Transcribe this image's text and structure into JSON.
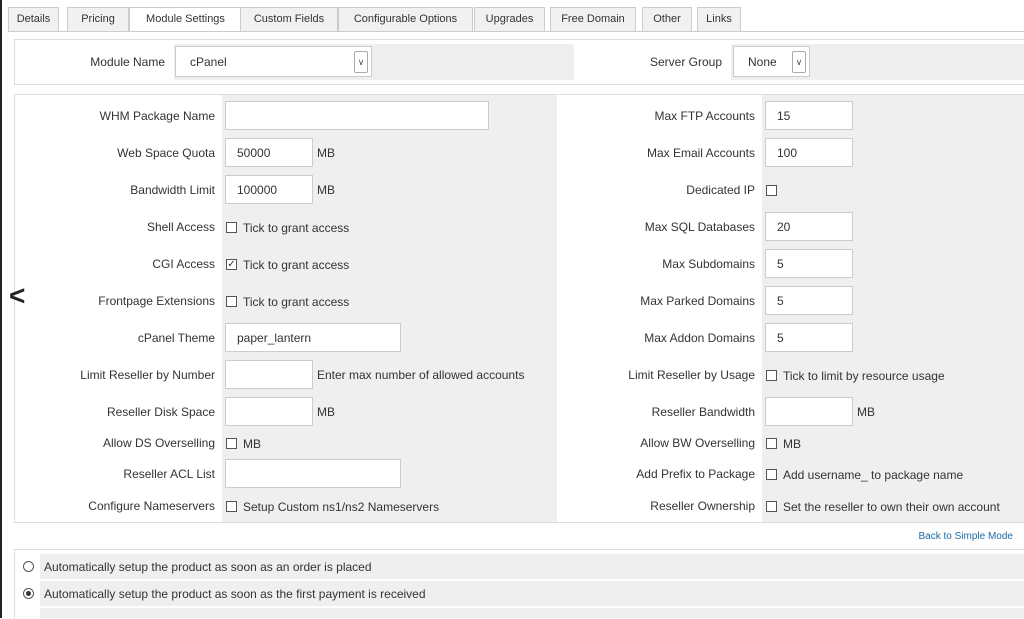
{
  "tabs": [
    {
      "label": "Details"
    },
    {
      "label": "Pricing"
    },
    {
      "label": "Module Settings"
    },
    {
      "label": "Custom Fields"
    },
    {
      "label": "Configurable Options"
    },
    {
      "label": "Upgrades"
    },
    {
      "label": "Free Domain"
    },
    {
      "label": "Other"
    },
    {
      "label": "Links"
    }
  ],
  "module": {
    "name_label": "Module Name",
    "name_value": "cPanel",
    "server_group_label": "Server Group",
    "server_group_value": "None"
  },
  "left": {
    "whm_package_name": {
      "label": "WHM Package Name",
      "value": ""
    },
    "web_space_quota": {
      "label": "Web Space Quota",
      "value": "50000",
      "unit": "MB"
    },
    "bandwidth_limit": {
      "label": "Bandwidth Limit",
      "value": "100000",
      "unit": "MB"
    },
    "shell_access": {
      "label": "Shell Access",
      "text": "Tick to grant access"
    },
    "cgi_access": {
      "label": "CGI Access",
      "text": "Tick to grant access"
    },
    "frontpage_extensions": {
      "label": "Frontpage Extensions",
      "text": "Tick to grant access"
    },
    "cpanel_theme": {
      "label": "cPanel Theme",
      "value": "paper_lantern"
    },
    "limit_reseller_number": {
      "label": "Limit Reseller by Number",
      "value": "",
      "text": "Enter max number of allowed accounts"
    },
    "reseller_disk_space": {
      "label": "Reseller Disk Space",
      "value": "",
      "unit": "MB"
    },
    "allow_ds_overselling": {
      "label": "Allow DS Overselling",
      "text": "MB"
    },
    "reseller_acl_list": {
      "label": "Reseller ACL List",
      "value": ""
    },
    "configure_nameservers": {
      "label": "Configure Nameservers",
      "text": "Setup Custom ns1/ns2 Nameservers"
    }
  },
  "right": {
    "max_ftp_accounts": {
      "label": "Max FTP Accounts",
      "value": "15"
    },
    "max_email_accounts": {
      "label": "Max Email Accounts",
      "value": "100"
    },
    "dedicated_ip": {
      "label": "Dedicated IP"
    },
    "max_sql_databases": {
      "label": "Max SQL Databases",
      "value": "20"
    },
    "max_subdomains": {
      "label": "Max Subdomains",
      "value": "5"
    },
    "max_parked_domains": {
      "label": "Max Parked Domains",
      "value": "5"
    },
    "max_addon_domains": {
      "label": "Max Addon Domains",
      "value": "5"
    },
    "limit_reseller_usage": {
      "label": "Limit Reseller by Usage",
      "text": "Tick to limit by resource usage"
    },
    "reseller_bandwidth": {
      "label": "Reseller Bandwidth",
      "value": "",
      "unit": "MB"
    },
    "allow_bw_overselling": {
      "label": "Allow BW Overselling",
      "text": "MB"
    },
    "add_prefix": {
      "label": "Add Prefix to Package",
      "text": "Add username_ to package name"
    },
    "reseller_ownership": {
      "label": "Reseller Ownership",
      "text": "Set the reseller to own their own account"
    }
  },
  "checks": {
    "shell_access": false,
    "cgi_access": true,
    "frontpage_extensions": false,
    "dedicated_ip": false,
    "limit_reseller_usage": false,
    "allow_ds_overselling": false,
    "allow_bw_overselling": false,
    "add_prefix": false,
    "configure_nameservers": false,
    "reseller_ownership": false
  },
  "back_to_simple_mode": "Back to Simple Mode",
  "setup": {
    "options": [
      {
        "label": "Automatically setup the product as soon as an order is placed",
        "selected": false
      },
      {
        "label": "Automatically setup the product as soon as the first payment is received",
        "selected": true
      }
    ]
  },
  "icons": {
    "back": "chevron-left-icon",
    "dropdown": "chevron-down-icon",
    "check": "✓"
  }
}
